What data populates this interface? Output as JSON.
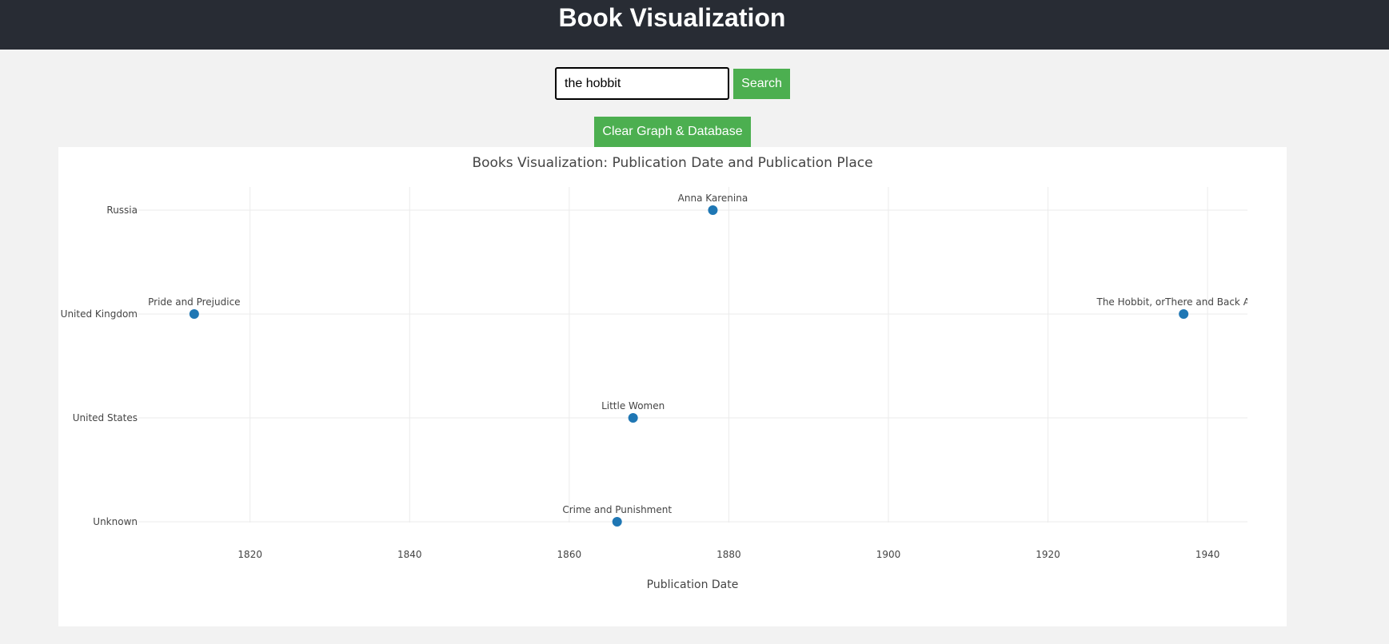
{
  "header": {
    "title": "Book Visualization"
  },
  "search": {
    "value": "the hobbit",
    "button_label": "Search"
  },
  "actions": {
    "clear_label": "Clear Graph & Database"
  },
  "chart_data": {
    "type": "scatter",
    "title": "Books Visualization: Publication Date and Publication Place",
    "xlabel": "Publication Date",
    "ylabel": "",
    "xlim": [
      1806,
      1945
    ],
    "x_ticks": [
      1820,
      1840,
      1860,
      1880,
      1900,
      1920,
      1940
    ],
    "categories": [
      "Unknown",
      "United States",
      "United Kingdom",
      "Russia"
    ],
    "grid": true,
    "marker_color": "#1f77b4",
    "points": [
      {
        "label": "Anna Karenina",
        "x": 1878,
        "y": "Russia"
      },
      {
        "label": "Pride and Prejudice",
        "x": 1813,
        "y": "United Kingdom"
      },
      {
        "label": "The Hobbit, orThere and Back Again",
        "x": 1937,
        "y": "United Kingdom"
      },
      {
        "label": "Little Women",
        "x": 1868,
        "y": "United States"
      },
      {
        "label": "Crime and Punishment",
        "x": 1866,
        "y": "Unknown"
      }
    ]
  }
}
